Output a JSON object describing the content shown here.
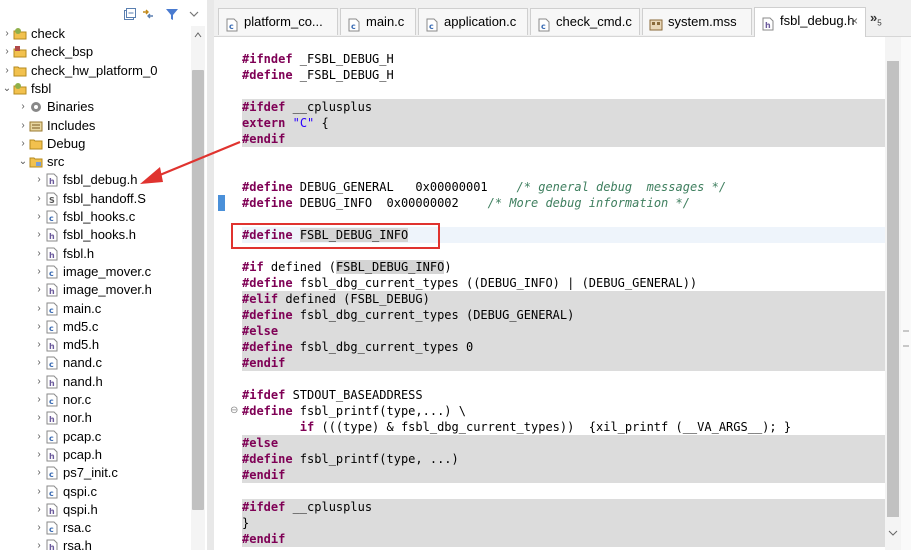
{
  "explorer": {
    "toolbar": {
      "collapse_icon": "collapse-all-icon",
      "link_icon": "link-with-editor-icon",
      "filter_icon": "filter-icon",
      "menu_icon": "view-menu-icon"
    },
    "items": [
      {
        "label": "check",
        "icon": "project-icon",
        "expanded": false
      },
      {
        "label": "check_bsp",
        "icon": "bsp-project-icon",
        "expanded": false
      },
      {
        "label": "check_hw_platform_0",
        "icon": "folder-icon",
        "expanded": false
      },
      {
        "label": "fsbl",
        "icon": "project-icon",
        "expanded": true
      },
      {
        "label": "Binaries",
        "icon": "binaries-icon",
        "expanded": false
      },
      {
        "label": "Includes",
        "icon": "includes-icon",
        "expanded": false
      },
      {
        "label": "Debug",
        "icon": "folder-icon",
        "expanded": false
      },
      {
        "label": "src",
        "icon": "source-folder-icon",
        "expanded": true
      },
      {
        "label": "fsbl_debug.h",
        "icon": "header-file-icon"
      },
      {
        "label": "fsbl_handoff.S",
        "icon": "asm-file-icon"
      },
      {
        "label": "fsbl_hooks.c",
        "icon": "c-file-icon"
      },
      {
        "label": "fsbl_hooks.h",
        "icon": "header-file-icon"
      },
      {
        "label": "fsbl.h",
        "icon": "header-file-icon"
      },
      {
        "label": "image_mover.c",
        "icon": "c-file-icon"
      },
      {
        "label": "image_mover.h",
        "icon": "header-file-icon"
      },
      {
        "label": "main.c",
        "icon": "c-file-icon"
      },
      {
        "label": "md5.c",
        "icon": "c-file-icon"
      },
      {
        "label": "md5.h",
        "icon": "header-file-icon"
      },
      {
        "label": "nand.c",
        "icon": "c-file-icon"
      },
      {
        "label": "nand.h",
        "icon": "header-file-icon"
      },
      {
        "label": "nor.c",
        "icon": "c-file-icon"
      },
      {
        "label": "nor.h",
        "icon": "header-file-icon"
      },
      {
        "label": "pcap.c",
        "icon": "c-file-icon"
      },
      {
        "label": "pcap.h",
        "icon": "header-file-icon"
      },
      {
        "label": "ps7_init.c",
        "icon": "c-file-icon"
      },
      {
        "label": "qspi.c",
        "icon": "c-file-icon"
      },
      {
        "label": "qspi.h",
        "icon": "header-file-icon"
      },
      {
        "label": "rsa.c",
        "icon": "c-file-icon"
      },
      {
        "label": "rsa.h",
        "icon": "header-file-icon"
      }
    ]
  },
  "tabs": [
    {
      "label": "platform_co...",
      "icon": "c-file-icon",
      "active": false
    },
    {
      "label": "main.c",
      "icon": "c-file-icon",
      "active": false
    },
    {
      "label": "application.c",
      "icon": "c-file-icon",
      "active": false
    },
    {
      "label": "check_cmd.c",
      "icon": "c-file-icon",
      "active": false
    },
    {
      "label": "system.mss",
      "icon": "mss-file-icon",
      "active": false
    },
    {
      "label": "fsbl_debug.h",
      "icon": "header-file-icon",
      "active": true,
      "close": "×"
    }
  ],
  "tab_overflow": {
    "label": "»",
    "count": "5"
  },
  "editor": {
    "lines": [
      {
        "segments": [
          {
            "t": "#ifndef",
            "c": "kw"
          },
          {
            "t": " _FSBL_DEBUG_H"
          }
        ]
      },
      {
        "segments": [
          {
            "t": "#define",
            "c": "kw"
          },
          {
            "t": " _FSBL_DEBUG_H"
          }
        ]
      },
      {
        "segments": []
      },
      {
        "bg": "inactive",
        "segments": [
          {
            "t": "#ifdef",
            "c": "kw"
          },
          {
            "t": " __cplusplus"
          }
        ]
      },
      {
        "bg": "inactive",
        "segments": [
          {
            "t": "extern",
            "c": "kw"
          },
          {
            "t": " "
          },
          {
            "t": "\"C\"",
            "c": "str"
          },
          {
            "t": " {"
          }
        ]
      },
      {
        "bg": "inactive",
        "segments": [
          {
            "t": "#endif",
            "c": "kw"
          }
        ]
      },
      {
        "segments": []
      },
      {
        "segments": []
      },
      {
        "segments": [
          {
            "t": "#define",
            "c": "kw"
          },
          {
            "t": " DEBUG_GENERAL   0x00000001    "
          },
          {
            "t": "/* general debug  messages */",
            "c": "cmt"
          }
        ]
      },
      {
        "segments": [
          {
            "t": "#define",
            "c": "kw"
          },
          {
            "t": " DEBUG_INFO  0x00000002    "
          },
          {
            "t": "/* More debug information */",
            "c": "cmt"
          }
        ]
      },
      {
        "segments": []
      },
      {
        "bg": "current",
        "segments": [
          {
            "t": "#define",
            "c": "kw"
          },
          {
            "t": " "
          },
          {
            "t": "FSBL_DEBUG_INFO",
            "c": "mhl"
          }
        ]
      },
      {
        "segments": []
      },
      {
        "segments": [
          {
            "t": "#if",
            "c": "kw"
          },
          {
            "t": " defined ("
          },
          {
            "t": "FSBL_DEBUG_INFO",
            "c": "mhl"
          },
          {
            "t": ")"
          }
        ]
      },
      {
        "segments": [
          {
            "t": "#define",
            "c": "kw"
          },
          {
            "t": " fsbl_dbg_current_types ((DEBUG_INFO) | (DEBUG_GENERAL))"
          }
        ]
      },
      {
        "bg": "inactive",
        "segments": [
          {
            "t": "#elif",
            "c": "kw"
          },
          {
            "t": " defined (FSBL_DEBUG)"
          }
        ]
      },
      {
        "bg": "inactive",
        "segments": [
          {
            "t": "#define",
            "c": "kw"
          },
          {
            "t": " fsbl_dbg_current_types (DEBUG_GENERAL)"
          }
        ]
      },
      {
        "bg": "inactive",
        "segments": [
          {
            "t": "#else",
            "c": "kw"
          }
        ]
      },
      {
        "bg": "inactive",
        "segments": [
          {
            "t": "#define",
            "c": "kw"
          },
          {
            "t": " fsbl_dbg_current_types 0"
          }
        ]
      },
      {
        "bg": "inactive",
        "segments": [
          {
            "t": "#endif",
            "c": "kw"
          }
        ]
      },
      {
        "segments": []
      },
      {
        "segments": [
          {
            "t": "#ifdef",
            "c": "kw"
          },
          {
            "t": " STDOUT_BASEADDRESS"
          }
        ]
      },
      {
        "fold": "⊖",
        "segments": [
          {
            "t": "#define",
            "c": "kw"
          },
          {
            "t": " fsbl_printf(type,...) \\"
          }
        ]
      },
      {
        "segments": [
          {
            "t": "        "
          },
          {
            "t": "if",
            "c": "kw"
          },
          {
            "t": " (((type) & fsbl_dbg_current_types))  {xil_printf (__VA_ARGS__); }"
          }
        ]
      },
      {
        "bg": "inactive",
        "segments": [
          {
            "t": "#else",
            "c": "kw"
          }
        ]
      },
      {
        "bg": "inactive",
        "segments": [
          {
            "t": "#define",
            "c": "kw"
          },
          {
            "t": " fsbl_printf(type, ...)"
          }
        ]
      },
      {
        "bg": "inactive",
        "segments": [
          {
            "t": "#endif",
            "c": "kw"
          }
        ]
      },
      {
        "segments": []
      },
      {
        "bg": "inactive",
        "segments": [
          {
            "t": "#ifdef",
            "c": "kw"
          },
          {
            "t": " __cplusplus"
          }
        ]
      },
      {
        "bg": "inactive",
        "segments": [
          {
            "t": "}"
          }
        ]
      },
      {
        "bg": "inactive",
        "segments": [
          {
            "t": "#endif",
            "c": "kw"
          }
        ]
      }
    ]
  },
  "colors": {
    "annotation": "#e0332f",
    "keyword": "#7f0055",
    "string": "#2a00ff",
    "comment": "#3f7f5f"
  }
}
